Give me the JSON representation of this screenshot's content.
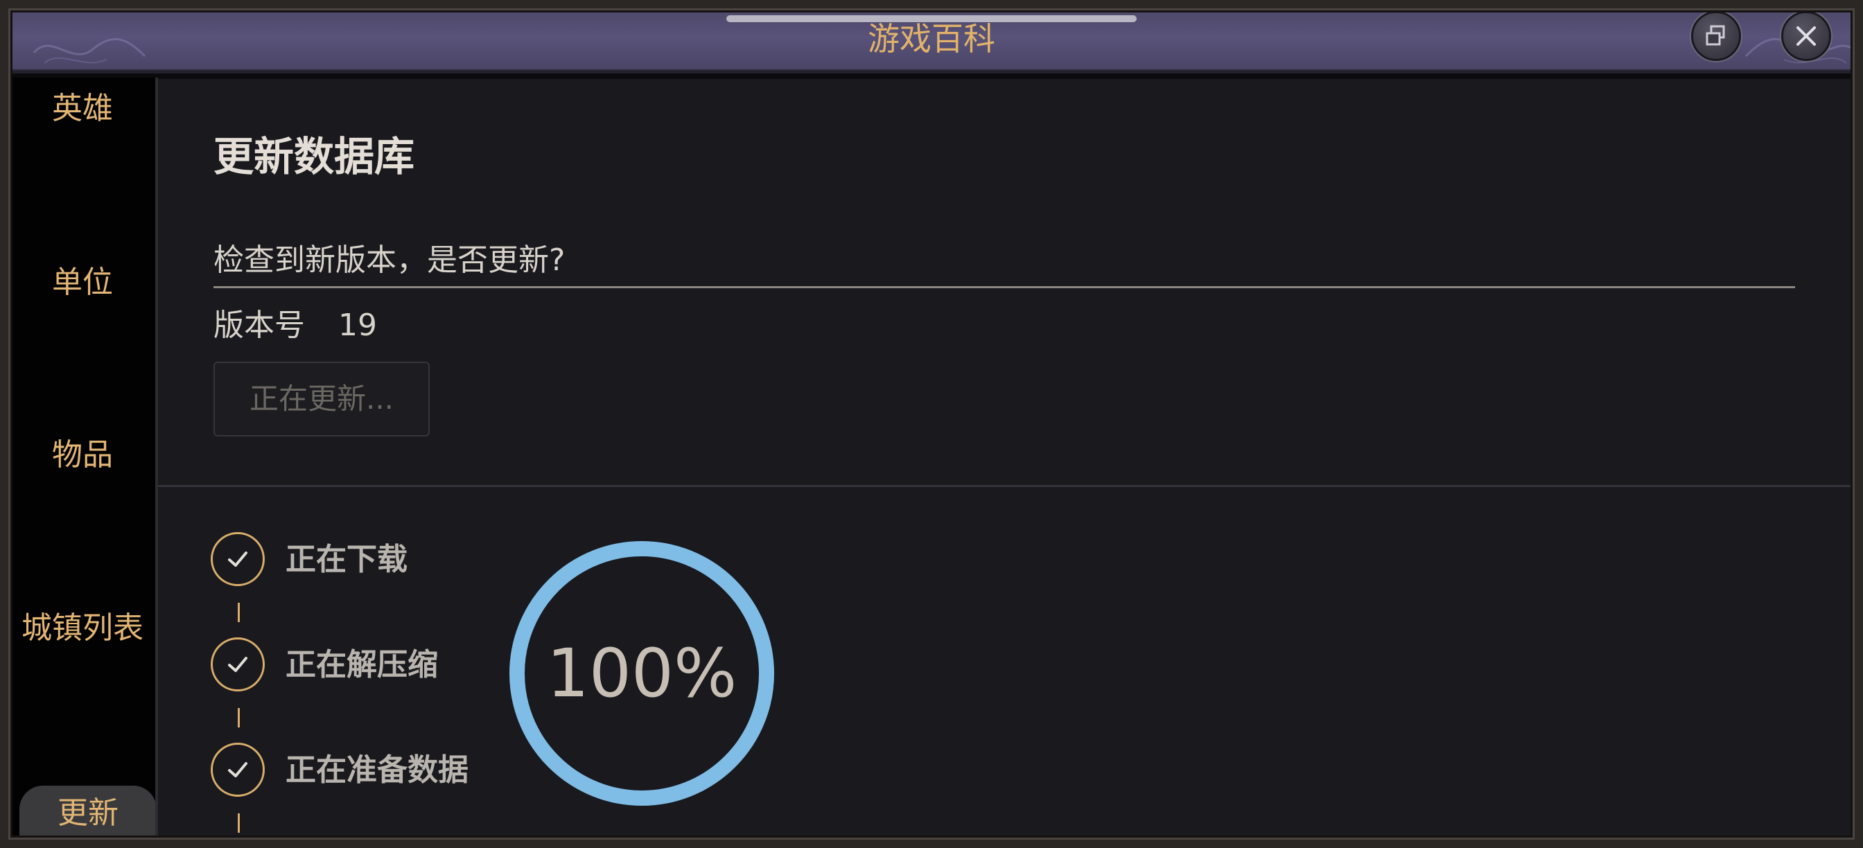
{
  "window": {
    "title": "游戏百科",
    "restore_icon": "restore-window-icon",
    "close_icon": "close-icon"
  },
  "sidebar": {
    "items": [
      {
        "label": "英雄",
        "active": false
      },
      {
        "label": "单位",
        "active": false
      },
      {
        "label": "物品",
        "active": false
      },
      {
        "label": "城镇列表",
        "active": false
      },
      {
        "label": "更新",
        "active": true
      }
    ]
  },
  "update_panel": {
    "heading": "更新数据库",
    "prompt": "检查到新版本，是否更新?",
    "version_label": "版本号",
    "version_value": "19",
    "button_label": "正在更新..."
  },
  "progress": {
    "steps": [
      {
        "label": "正在下载",
        "icon": "check-icon",
        "done": true
      },
      {
        "label": "正在解压缩",
        "icon": "check-icon",
        "done": true
      },
      {
        "label": "正在准备数据",
        "icon": "check-icon",
        "done": true
      }
    ],
    "percent_text": "100%",
    "percent_value": 100
  },
  "colors": {
    "accent_gold": "#e2b574",
    "progress_ring": "#7fbde6",
    "panel_bg": "#19191e",
    "titlebar": "#59527a"
  }
}
